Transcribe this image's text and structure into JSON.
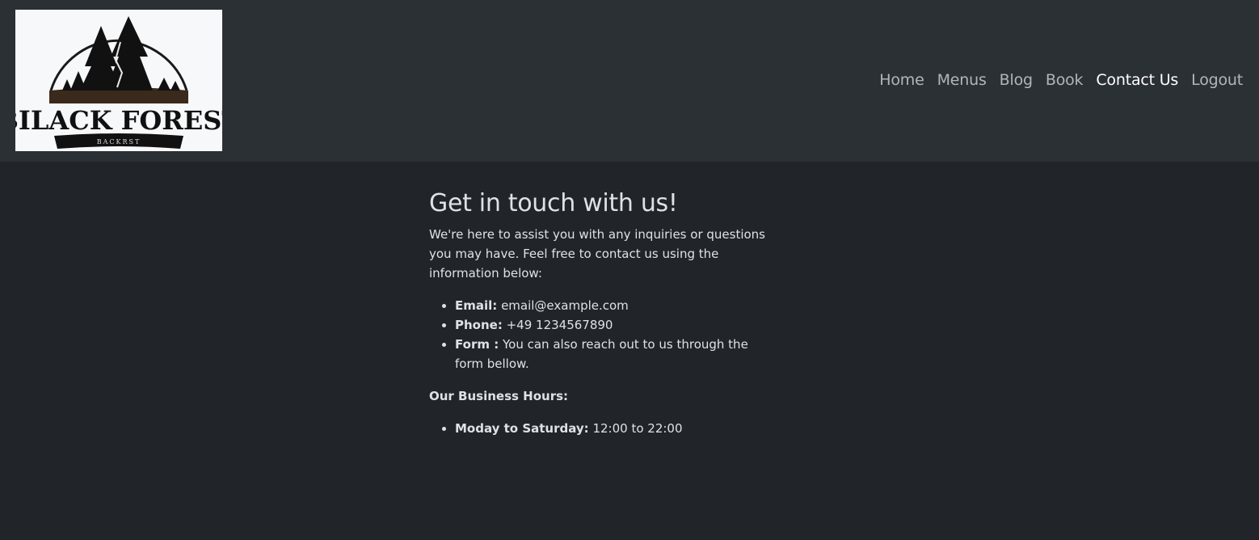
{
  "brand": {
    "logo_text": "BILACK FOREST",
    "logo_subtext": "BACKRST"
  },
  "nav": {
    "items": [
      {
        "label": "Home",
        "active": false
      },
      {
        "label": "Menus",
        "active": false
      },
      {
        "label": "Blog",
        "active": false
      },
      {
        "label": "Book",
        "active": false
      },
      {
        "label": "Contact Us",
        "active": true
      },
      {
        "label": "Logout",
        "active": false
      }
    ]
  },
  "main": {
    "heading": "Get in touch with us!",
    "intro": "We're here to assist you with any inquiries or questions you may have. Feel free to contact us using the information below:",
    "contacts": [
      {
        "label": "Email:",
        "value": "email@example.com"
      },
      {
        "label": "Phone:",
        "value": "+49 1234567890"
      },
      {
        "label": "Form :",
        "value": "You can also reach out to us through the form bellow."
      }
    ],
    "hours_title": "Our Business Hours:",
    "hours": [
      {
        "label": "Moday to Saturday:",
        "value": "12:00 to 22:00"
      }
    ]
  },
  "colors": {
    "page_bg": "#212529",
    "navbar_bg": "#2b3035",
    "text": "#dee2e6",
    "nav_active": "#ffffff"
  }
}
